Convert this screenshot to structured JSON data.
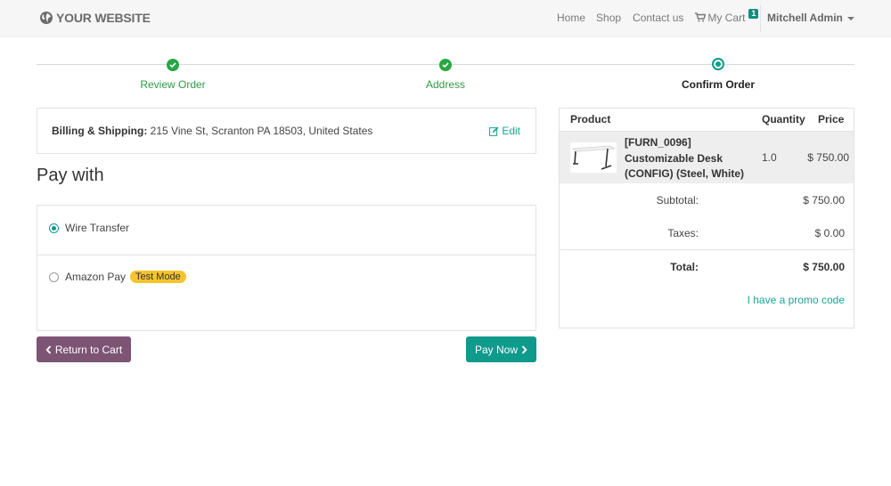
{
  "navbar": {
    "brand": "YOUR WEBSITE",
    "links": {
      "home": "Home",
      "shop": "Shop",
      "contact": "Contact us"
    },
    "cart": {
      "label": "My Cart",
      "count": "1"
    },
    "user": "Mitchell Admin"
  },
  "wizard": {
    "steps": [
      {
        "label": "Review Order",
        "state": "done"
      },
      {
        "label": "Address",
        "state": "done"
      },
      {
        "label": "Confirm Order",
        "state": "current"
      }
    ]
  },
  "billing": {
    "label": "Billing & Shipping:",
    "address": "215 Vine St, Scranton PA 18503, United States",
    "edit": "Edit"
  },
  "payment": {
    "heading": "Pay with",
    "methods": [
      {
        "label": "Wire Transfer",
        "selected": true
      },
      {
        "label": "Amazon Pay",
        "badge": "Test Mode",
        "selected": false
      }
    ]
  },
  "buttons": {
    "return": "Return to Cart",
    "pay": "Pay Now"
  },
  "summary": {
    "headers": {
      "product": "Product",
      "quantity": "Quantity",
      "price": "Price"
    },
    "product": {
      "name": "[FURN_0096] Customizable Desk (CONFIG) (Steel, White)",
      "quantity": "1.0",
      "price": "$ 750.00"
    },
    "subtotal": {
      "label": "Subtotal:",
      "value": "$ 750.00"
    },
    "taxes": {
      "label": "Taxes:",
      "value": "$ 0.00"
    },
    "total": {
      "label": "Total:",
      "value": "$ 750.00"
    },
    "promo": "I have a promo code"
  },
  "colors": {
    "accent": "#0f9a8c",
    "success": "#28a745",
    "secondary": "#7d5474",
    "badge": "#f5c42c"
  }
}
